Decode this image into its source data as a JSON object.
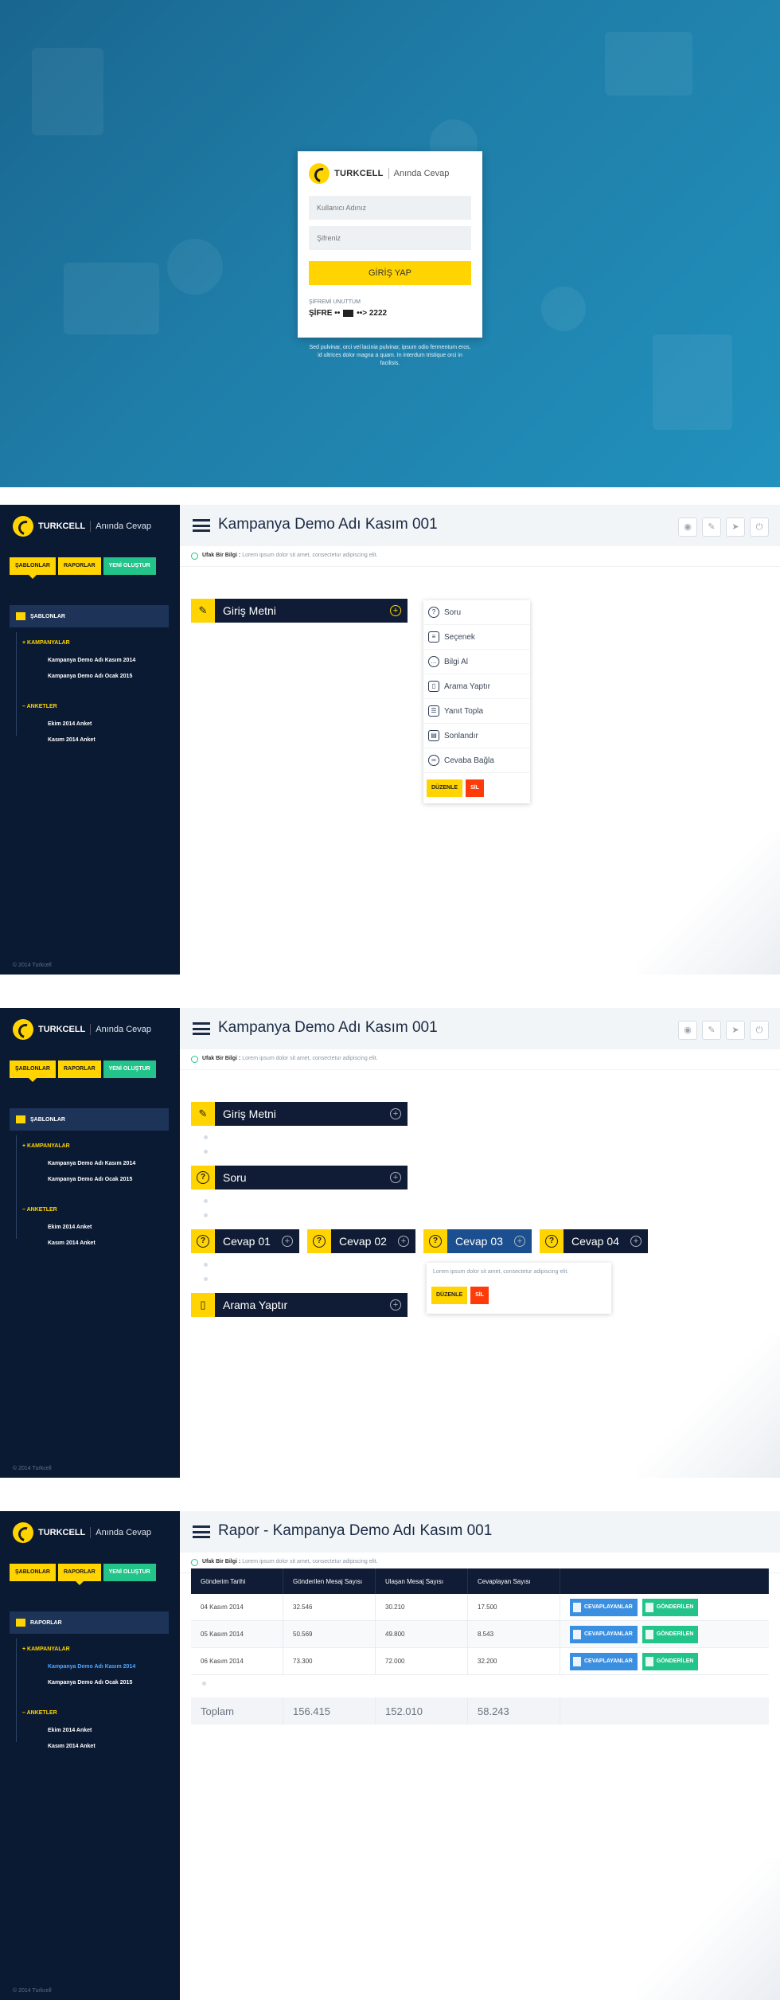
{
  "brand": {
    "name": "TURKCELL",
    "product": "Anında Cevap"
  },
  "login": {
    "username_placeholder": "Kullanıcı Adınız",
    "password_placeholder": "Şifreniz",
    "submit_label": "GİRİŞ YAP",
    "forgot_label": "ŞİFREMİ UNUTTUM",
    "sms_prefix": "ŞİFRE ••",
    "sms_suffix": "••> 2222",
    "note": "Sed pulvinar, orci vel lacinia pulvinar, ipsum odio fermentum eros, id ultrices dolor magna a quam. In interdum tristique orci in facilisis."
  },
  "sidebar": {
    "tabs": [
      "ŞABLONLAR",
      "RAPORLAR",
      "YENİ OLUŞTUR"
    ],
    "section_templates": "ŞABLONLAR",
    "section_reports": "RAPORLAR",
    "group_campaigns": "KAMPANYALAR",
    "group_surveys": "ANKETLER",
    "campaigns": [
      "Kampanya Demo Adı Kasım 2014",
      "Kampanya Demo Adı Ocak 2015"
    ],
    "surveys": [
      "Ekim 2014 Anket",
      "Kasım 2014 Anket"
    ],
    "footer": "© 2014 Turkcell"
  },
  "header": {
    "title": "Kampanya Demo Adı Kasım 001",
    "report_title": "Rapor - Kampanya Demo Adı Kasım 001"
  },
  "info": {
    "label": "Ufak Bir Bilgi :",
    "text": "Lorem ipsum dolor sit amet, consectetur adipiscing elit."
  },
  "flow1": {
    "intro": "Giriş Metni",
    "menu": [
      "Soru",
      "Seçenek",
      "Bilgi Al",
      "Arama Yaptır",
      "Yanıt Topla",
      "Sonlandır",
      "Cevaba Bağla"
    ],
    "edit": "DÜZENLE",
    "delete": "SİL"
  },
  "flow2": {
    "intro": "Giriş Metni",
    "question": "Soru",
    "answers": [
      "Cevap 01",
      "Cevap 02",
      "Cevap 03",
      "Cevap 04"
    ],
    "popup_text": "Lorem ipsum dolor sit amet, consectetur adipiscing elit.",
    "call": "Arama Yaptır",
    "edit": "DÜZENLE",
    "delete": "SİL"
  },
  "report": {
    "columns": [
      "Gönderim Tarihi",
      "Gönderilen Mesaj Sayısı",
      "Ulaşan Mesaj Sayısı",
      "Cevaplayan Sayısı"
    ],
    "rows": [
      [
        "04 Kasım 2014",
        "32.546",
        "30.210",
        "17.500"
      ],
      [
        "05 Kasım 2014",
        "50.569",
        "49.800",
        "8.543"
      ],
      [
        "06 Kasım 2014",
        "73.300",
        "72.000",
        "32.200"
      ]
    ],
    "btn_responders": "CEVAPLAYANLAR",
    "btn_sent": "GÖNDERİLEN",
    "total": [
      "Toplam",
      "156.415",
      "152.010",
      "58.243"
    ]
  },
  "colors": {
    "accent": "#ffd400",
    "navy": "#0b1a33",
    "green": "#23c48a",
    "blue": "#3b8fe0",
    "red": "#ff3b0a"
  }
}
